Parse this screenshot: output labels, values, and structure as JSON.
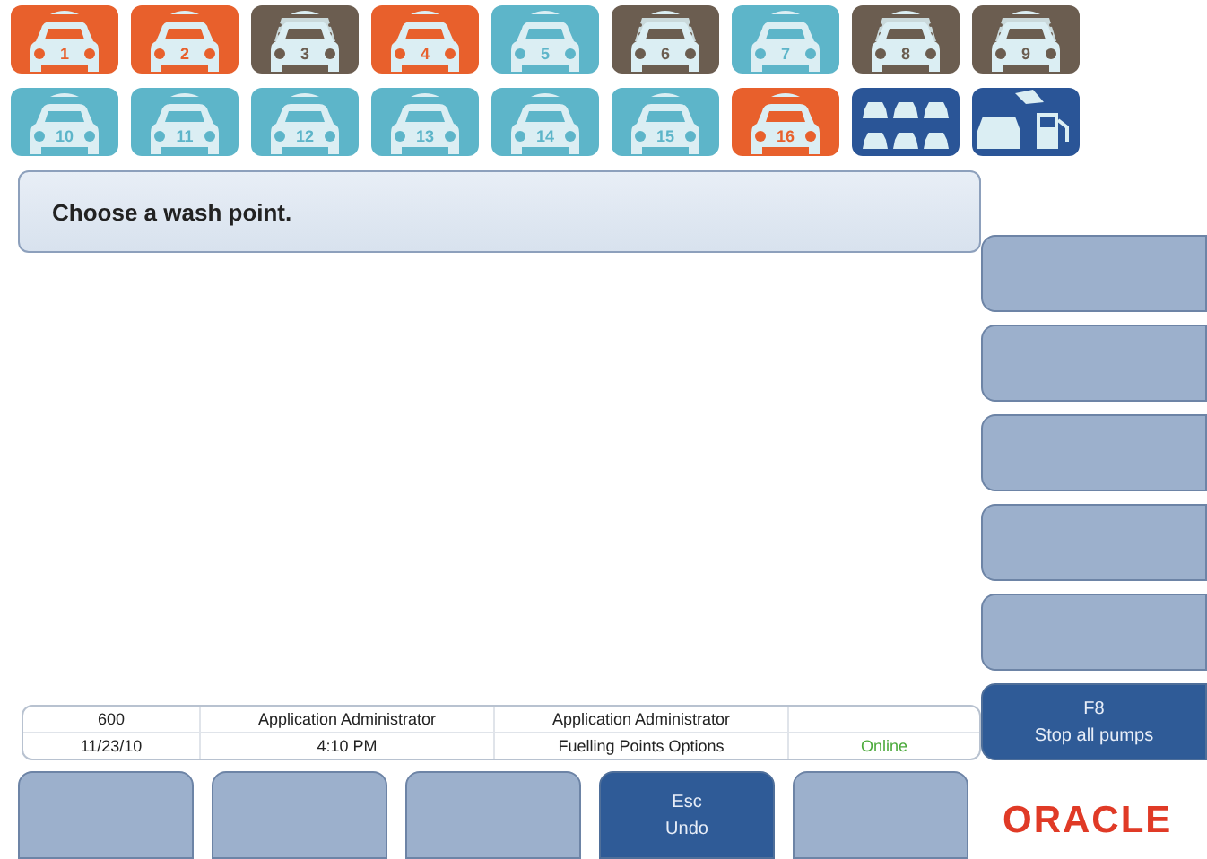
{
  "wash_points": [
    {
      "number": "1",
      "kind": "car",
      "color": "#e8602c"
    },
    {
      "number": "2",
      "kind": "car",
      "color": "#e8602c"
    },
    {
      "number": "3",
      "kind": "washing",
      "color": "#6b5d50"
    },
    {
      "number": "4",
      "kind": "car",
      "color": "#e8602c"
    },
    {
      "number": "5",
      "kind": "car",
      "color": "#5db5c9"
    },
    {
      "number": "6",
      "kind": "washing",
      "color": "#6b5d50"
    },
    {
      "number": "7",
      "kind": "car",
      "color": "#5db5c9"
    },
    {
      "number": "8",
      "kind": "washing",
      "color": "#6b5d50"
    },
    {
      "number": "9",
      "kind": "washing",
      "color": "#6b5d50"
    },
    {
      "number": "10",
      "kind": "car",
      "color": "#5db5c9"
    },
    {
      "number": "11",
      "kind": "car",
      "color": "#5db5c9"
    },
    {
      "number": "12",
      "kind": "car",
      "color": "#5db5c9"
    },
    {
      "number": "13",
      "kind": "car",
      "color": "#5db5c9"
    },
    {
      "number": "14",
      "kind": "car",
      "color": "#5db5c9"
    },
    {
      "number": "15",
      "kind": "car",
      "color": "#5db5c9"
    },
    {
      "number": "16",
      "kind": "car",
      "color": "#e8602c"
    }
  ],
  "mode_buttons": [
    {
      "kind": "all_points"
    },
    {
      "kind": "wash_and_fuel"
    }
  ],
  "message": "Choose a wash point.",
  "side_buttons": [
    {
      "disabled": true
    },
    {
      "disabled": true
    },
    {
      "disabled": true
    },
    {
      "disabled": true
    },
    {
      "disabled": true
    },
    {
      "key": "F8",
      "label": "Stop all pumps",
      "disabled": false
    }
  ],
  "status_bar": {
    "rows": [
      [
        "600",
        "Application Administrator",
        "Application Administrator",
        ""
      ],
      [
        "11/23/10",
        "4:10 PM",
        "Fuelling Points Options",
        "Online"
      ]
    ]
  },
  "bottom_buttons": [
    {
      "disabled": true
    },
    {
      "disabled": true
    },
    {
      "disabled": true
    },
    {
      "key": "Esc",
      "label": "Undo",
      "disabled": false
    },
    {
      "disabled": true
    }
  ],
  "logo": "ORACLE"
}
